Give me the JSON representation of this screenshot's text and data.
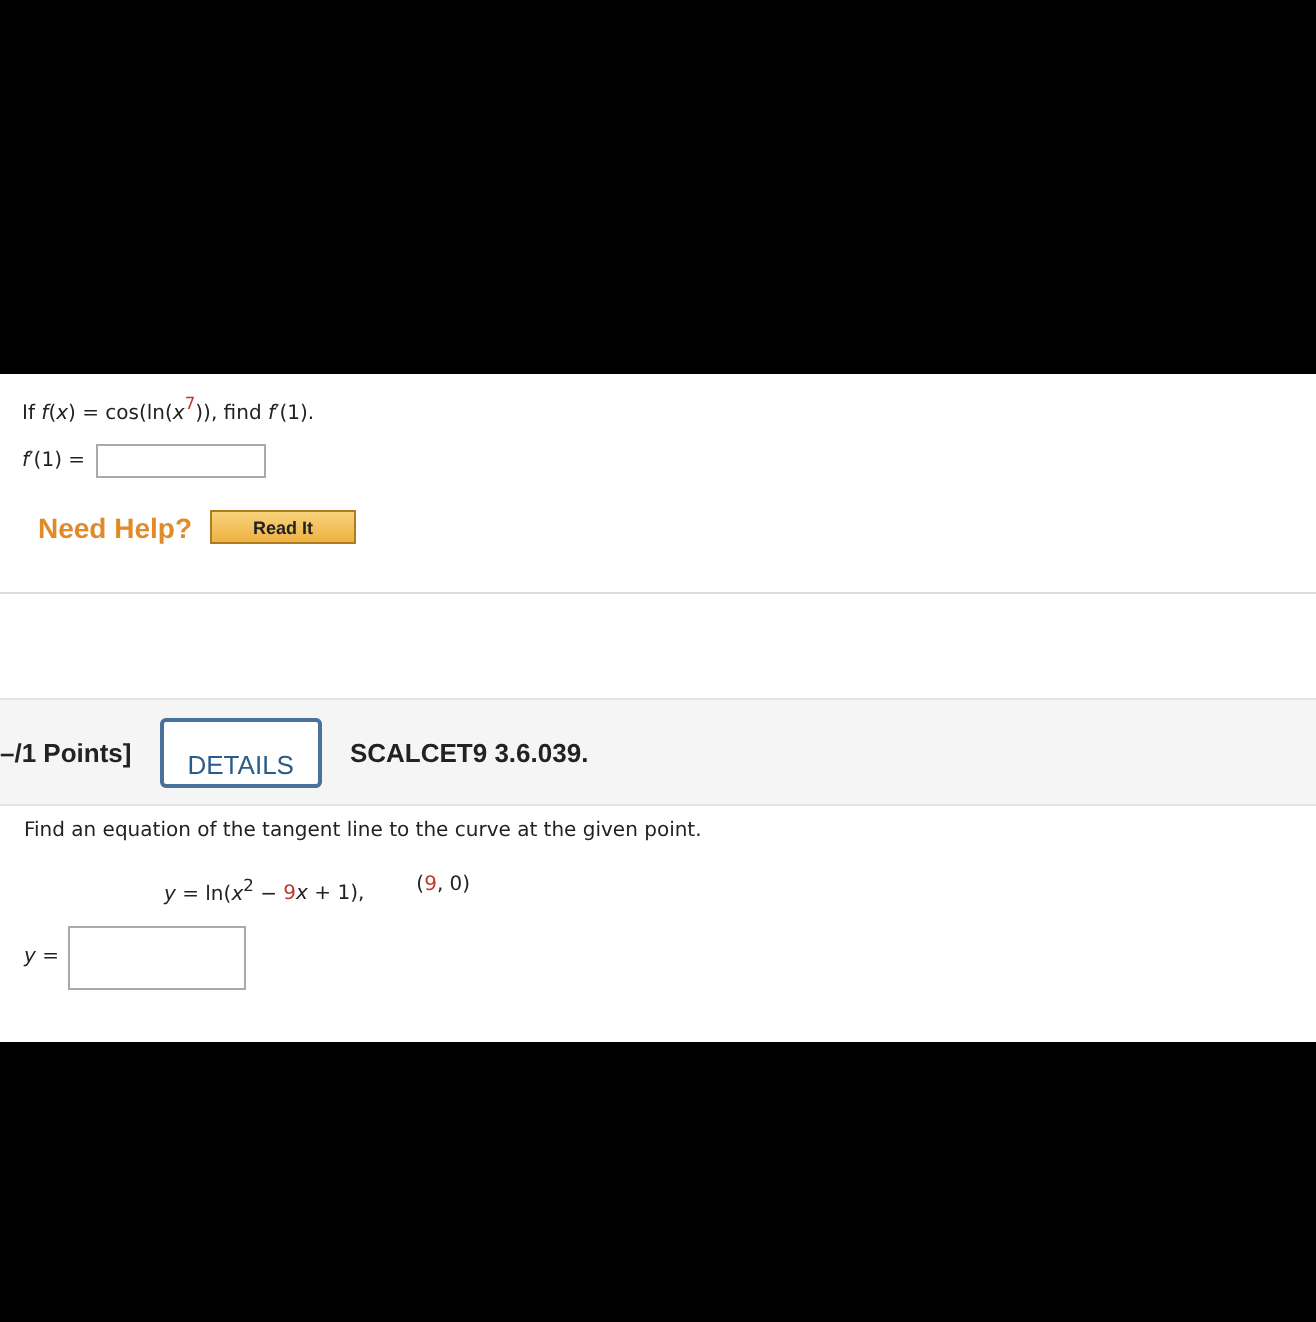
{
  "question1": {
    "prompt": [
      {
        "text": "If *f*(*x*) = cos(ln(*x*",
        "red": false
      },
      {
        "text": "$^{7}$",
        "red": true
      },
      {
        "text": ")), find *f*′(1).",
        "red": false
      }
    ],
    "answer_label": "*f*′(1) =",
    "help_label": "Need Help?",
    "help_button": "Read It"
  },
  "question2": {
    "points": "–/1 Points]",
    "details_button": "DETAILS",
    "code": "SCALCET9 3.6.039.",
    "prompt": "Find an equation of the tangent line to the curve at the given point.",
    "equation": [
      {
        "text": "*y* = ln(*x*$^{2}$ − ",
        "red": false
      },
      {
        "text": "9",
        "red": true
      },
      {
        "text": "*x* + 1),",
        "red": false
      }
    ],
    "point": [
      {
        "text": "(",
        "red": false
      },
      {
        "text": "9",
        "red": true
      },
      {
        "text": ", 0)",
        "red": false
      }
    ],
    "answer_label": "*y* ="
  }
}
